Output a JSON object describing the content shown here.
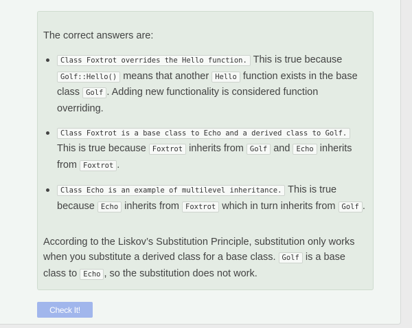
{
  "feedback": {
    "intro": "The correct answers are:",
    "answers": [
      {
        "code1": "Class Foxtrot overrides the Hello function.",
        "t1": " This is true because ",
        "code2": "Golf::Hello()",
        "t2": " means that another ",
        "code3": "Hello",
        "t3": " function exists in the base class ",
        "code4": "Golf",
        "t4": ". Adding new functionality is considered function overriding."
      },
      {
        "code1": "Class Foxtrot is a base class to Echo and a derived class to Golf.",
        "t1": " This is true because ",
        "code2": "Foxtrot",
        "t2": " inherits from ",
        "code3": "Golf",
        "t3": " and ",
        "code4": "Echo",
        "t4": " inherits from ",
        "code5": "Foxtrot",
        "t5": "."
      },
      {
        "code1": "Class Echo is an example of multilevel inheritance.",
        "t1": " This is true because ",
        "code2": "Echo",
        "t2": " inherits from ",
        "code3": "Foxtrot",
        "t3": " which in turn inherits from ",
        "code4": "Golf",
        "t4": "."
      }
    ],
    "conclusion": {
      "t1": "According to the Liskov’s Substitution Principle, substitution only works when you substitute a derived class for a base class. ",
      "code1": "Golf",
      "t2": " is a base class to ",
      "code2": "Echo",
      "t3": ", so the substitution does not work."
    }
  },
  "check_button": {
    "label": "Check It!"
  },
  "colors": {
    "feedback_bg": "#e4ece4",
    "button_bg": "#a1b6ec",
    "text": "#434343"
  }
}
